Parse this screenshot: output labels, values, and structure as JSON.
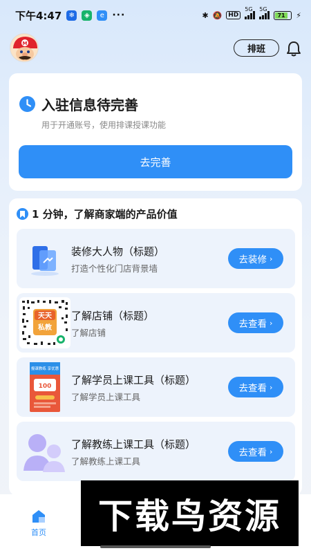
{
  "status_bar": {
    "time": "下午4:47",
    "more": "···",
    "network_5g_1": "5G",
    "network_5g_2": "5G",
    "hd": "HD",
    "battery": "71"
  },
  "header": {
    "schedule_button": "排班"
  },
  "onboarding": {
    "title": "入驻信息待完善",
    "subtitle": "用于开通账号，使用排课授课功能",
    "button": "去完善"
  },
  "products": {
    "section_title": "1 分钟，了解商家端的产品价值",
    "items": [
      {
        "title": "装修大人物（标题）",
        "subtitle": "打造个性化门店背景墙",
        "button": "去装修"
      },
      {
        "title": "了解店铺（标题）",
        "subtitle": "了解店铺",
        "button": "去查看"
      },
      {
        "title": "了解学员上课工具（标题）",
        "subtitle": "了解学员上课工具",
        "button": "去查看"
      },
      {
        "title": "了解教练上课工具（标题）",
        "subtitle": "了解教练上课工具",
        "button": "去查看"
      }
    ]
  },
  "qr_badge": {
    "line1": "天天",
    "line2": "私教"
  },
  "poster": {
    "line1": "报课教练 享优惠",
    "amount": "100"
  },
  "tabbar": {
    "home_label": "首页"
  },
  "watermark": {
    "text": "下载鸟资源"
  },
  "colors": {
    "accent": "#2f8ff7",
    "card_item_bg": "#edf3fc"
  }
}
